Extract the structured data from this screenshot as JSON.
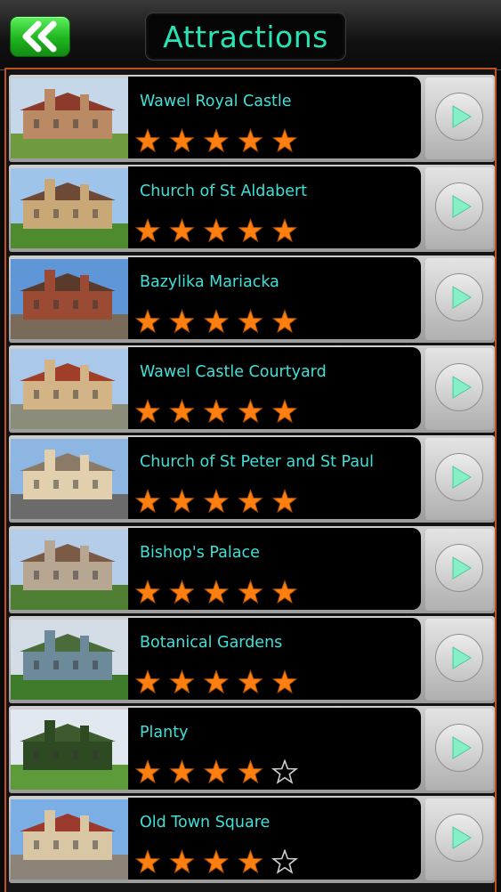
{
  "header": {
    "title": "Attractions",
    "back_icon": "double-chevron-left-icon"
  },
  "colors": {
    "accent": "#28e3b6",
    "name_text": "#40e0d8",
    "star": "#ff7f11",
    "frame": "#c1501a"
  },
  "attractions": [
    {
      "name": "Wawel Royal Castle",
      "rating": 5
    },
    {
      "name": "Church of St Aldabert",
      "rating": 5
    },
    {
      "name": "Bazylika Mariacka",
      "rating": 5
    },
    {
      "name": "Wawel Castle Courtyard",
      "rating": 5
    },
    {
      "name": "Church of St Peter and St Paul",
      "rating": 5
    },
    {
      "name": "Bishop's Palace",
      "rating": 5
    },
    {
      "name": "Botanical Gardens",
      "rating": 5
    },
    {
      "name": "Planty",
      "rating": 4
    },
    {
      "name": "Old Town Square",
      "rating": 4
    }
  ]
}
